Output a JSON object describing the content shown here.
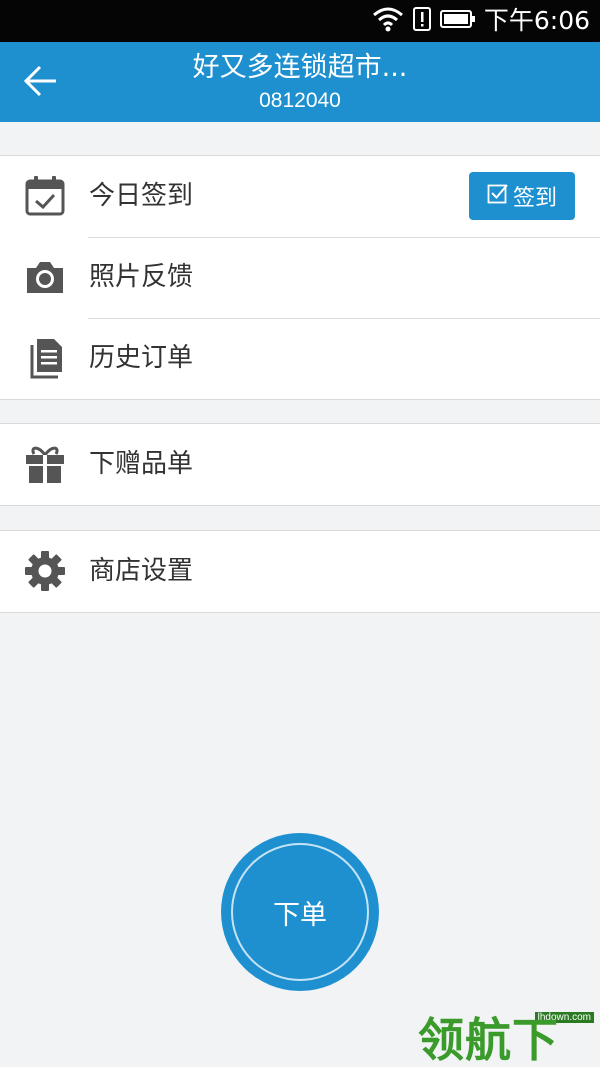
{
  "status_bar": {
    "time": "下午6:06",
    "icons": [
      "wifi-icon",
      "alert-icon",
      "battery-icon"
    ]
  },
  "header": {
    "title": "好又多连锁超市...",
    "subtitle": "0812040",
    "back_icon": "arrow-left-icon"
  },
  "groups": [
    {
      "items": [
        {
          "label": "今日签到",
          "icon": "calendar-check-icon",
          "action_label": "签到",
          "action_icon": "checkbox-icon"
        },
        {
          "label": "照片反馈",
          "icon": "camera-icon"
        },
        {
          "label": "历史订单",
          "icon": "document-icon"
        }
      ]
    },
    {
      "items": [
        {
          "label": "下赠品单",
          "icon": "gift-icon"
        }
      ]
    },
    {
      "items": [
        {
          "label": "商店设置",
          "icon": "gear-icon"
        }
      ]
    }
  ],
  "fab": {
    "label": "下单"
  },
  "watermark": {
    "text": "领航下载",
    "url": "lhdown.com"
  },
  "colors": {
    "primary": "#1e90d0",
    "background": "#f2f3f5",
    "icon": "#555555",
    "text": "#333333"
  }
}
